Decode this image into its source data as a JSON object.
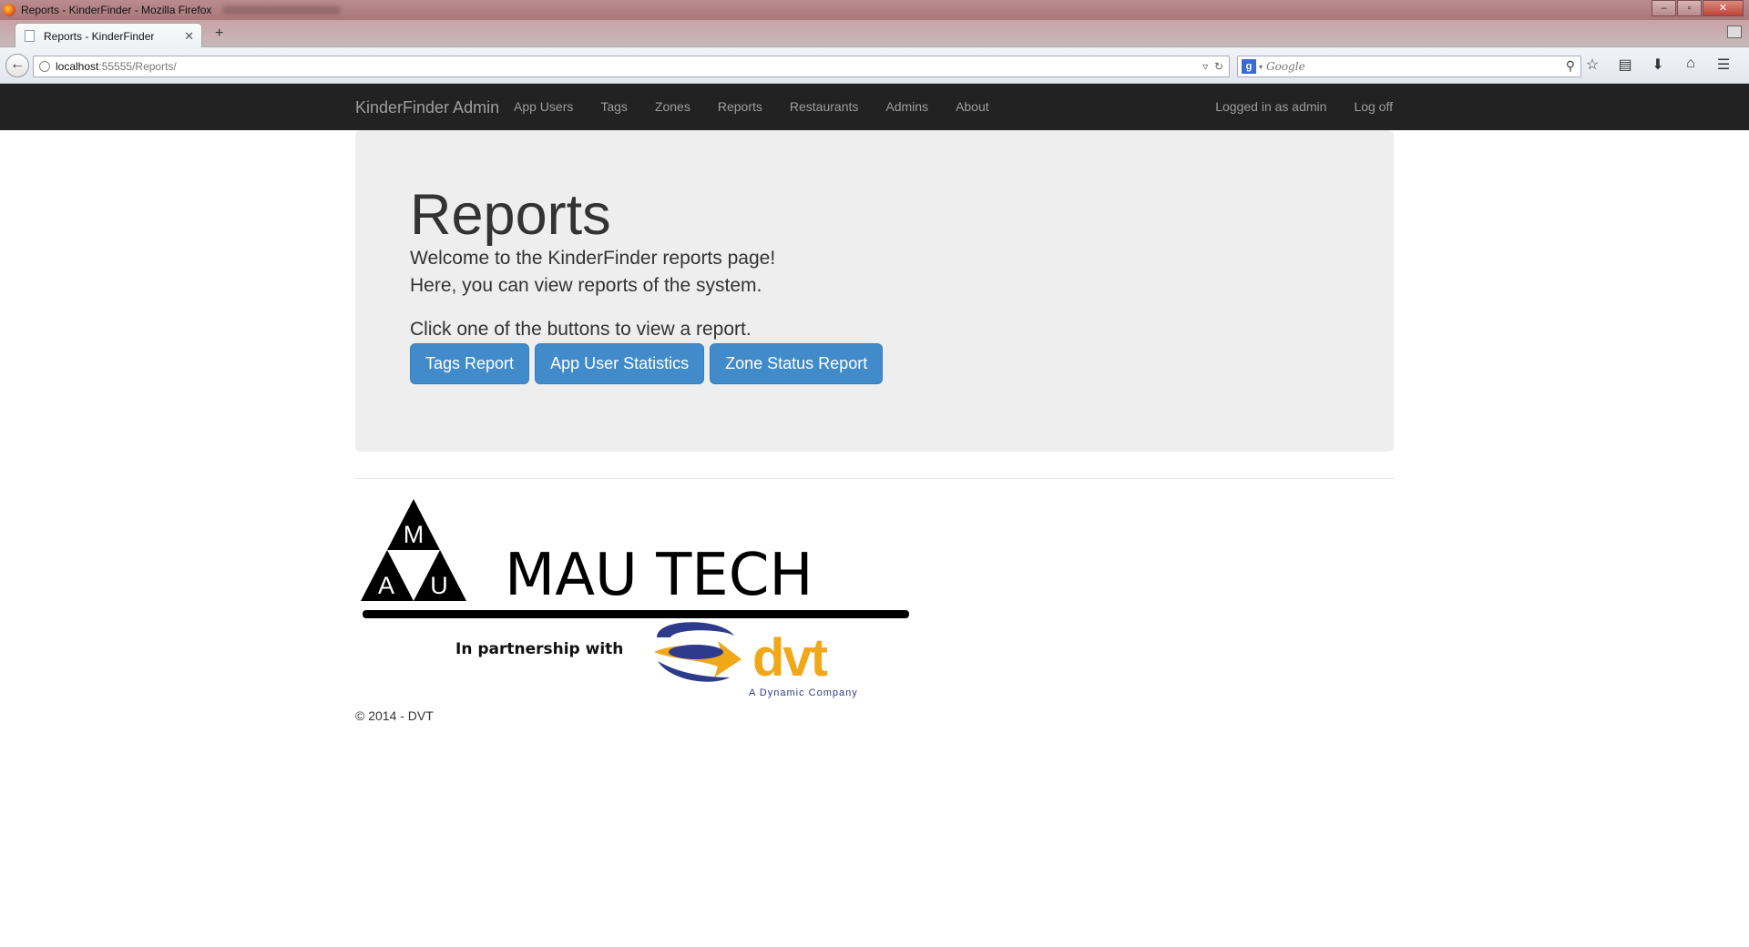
{
  "browser": {
    "window_title": "Reports - KinderFinder - Mozilla Firefox",
    "tab_label": "Reports - KinderFinder",
    "url_host": "localhost",
    "url_rest": ":55555/Reports/",
    "search_placeholder": "Google",
    "new_tab_glyph": "+",
    "tab_close_glyph": "✕"
  },
  "site": {
    "brand": "KinderFinder Admin",
    "nav": [
      "App Users",
      "Tags",
      "Zones",
      "Reports",
      "Restaurants",
      "Admins",
      "About"
    ],
    "user_status": "Logged in as admin",
    "logoff": "Log off"
  },
  "jumbotron": {
    "heading": "Reports",
    "line1": "Welcome to the KinderFinder reports page!",
    "line2": "Here, you can view reports of the system.",
    "line3": "Click one of the buttons to view a report.",
    "buttons": [
      "Tags Report",
      "App User Statistics",
      "Zone Status Report"
    ]
  },
  "footer": {
    "logo_letters": [
      "M",
      "A",
      "U"
    ],
    "logo_name": "MAU TECH",
    "partnership": "In partnership with",
    "partner_name": "dvt",
    "partner_tagline": "A Dynamic Company",
    "copyright": "© 2014 - DVT"
  },
  "colors": {
    "navbar_bg": "#222222",
    "jumbotron_bg": "#eeeeee",
    "button_primary": "#428bca",
    "dvt_blue": "#2e3a8c",
    "dvt_orange": "#f0a818"
  },
  "icons": [
    "back-arrow-icon",
    "globe-icon",
    "reload-icon",
    "magnifier-icon",
    "star-icon",
    "reading-list-icon",
    "download-icon",
    "home-icon",
    "menu-icon"
  ]
}
